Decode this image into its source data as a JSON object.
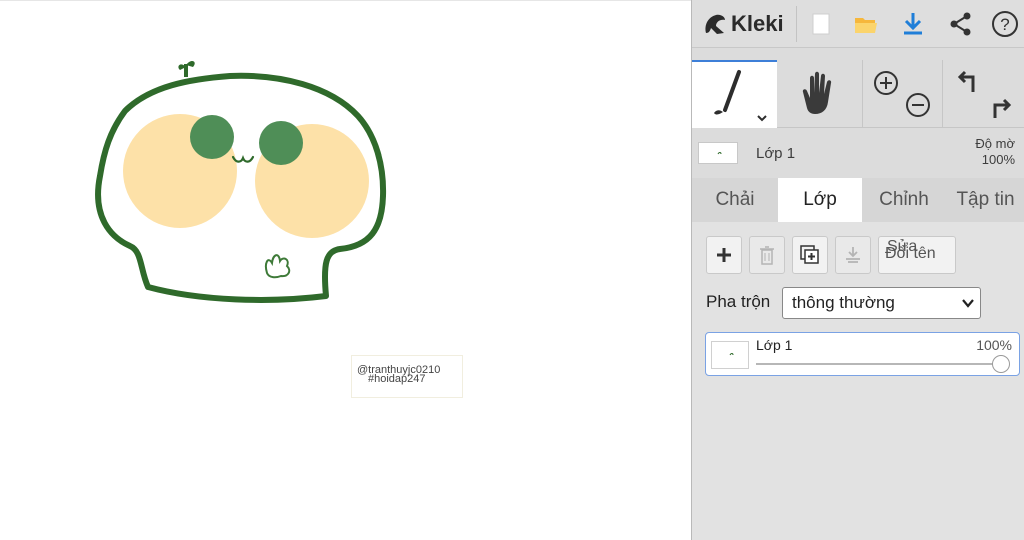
{
  "app": {
    "name": "Kleki"
  },
  "canvas": {
    "watermark": {
      "line1": "@tranthuyjc0210",
      "line2": "#hoidap247"
    },
    "character_colors": {
      "outline": "#2f6a2b",
      "cheeks": "#fde1a8",
      "eyes": "#4f8e57"
    }
  },
  "topbar": {
    "icons": [
      "kleki-logo-icon",
      "new-document-icon",
      "open-folder-icon",
      "download-icon",
      "share-icon",
      "help-icon"
    ],
    "accent": "#1f7ed8"
  },
  "tools": [
    "brush-icon",
    "hand-icon",
    "zoom-in-icon",
    "zoom-out-icon",
    "undo-icon",
    "redo-icon"
  ],
  "layer_header": {
    "name": "Lớp 1",
    "opacity_label": "Độ mờ",
    "opacity_value": "100%"
  },
  "tabs": [
    {
      "label": "Chải",
      "active": false
    },
    {
      "label": "Lớp",
      "active": true
    },
    {
      "label": "Chỉnh",
      "active": false
    },
    {
      "label": "Tập tin",
      "active": false
    }
  ],
  "layer_panel": {
    "buttons": [
      "add-layer-icon",
      "delete-layer-icon",
      "duplicate-layer-icon",
      "merge-down-icon"
    ],
    "rename_text_1": "Sửa",
    "rename_text_2": "Đổi tên",
    "blend_label": "Pha trộn",
    "blend_value": "thông thường",
    "layers": [
      {
        "name": "Lớp 1",
        "opacity": "100%",
        "opacity_fraction": 1.0
      }
    ]
  }
}
